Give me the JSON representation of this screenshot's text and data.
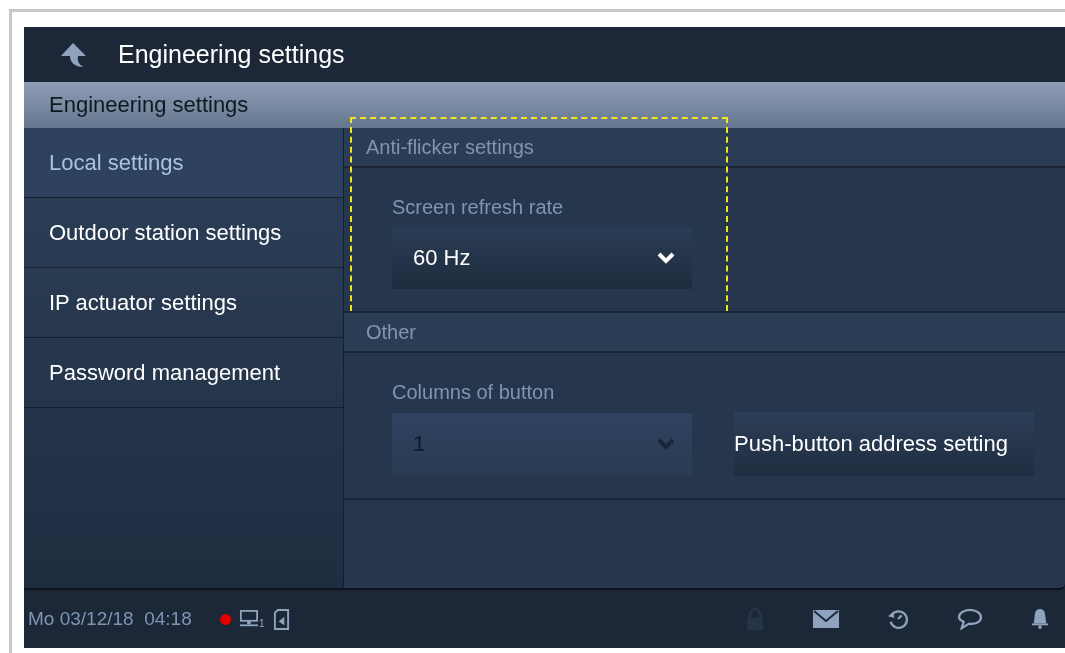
{
  "window": {
    "title": "Engineering settings"
  },
  "header": "Engineering settings",
  "sidebar": {
    "items": [
      {
        "label": "Local settings",
        "selected": true
      },
      {
        "label": "Outdoor station settings",
        "selected": false
      },
      {
        "label": "IP actuator settings",
        "selected": false
      },
      {
        "label": "Password management",
        "selected": false
      }
    ]
  },
  "sections": [
    {
      "title": "Anti-flicker settings",
      "highlighted": true,
      "fields": [
        {
          "label": "Screen refresh rate",
          "value": "60 Hz",
          "disabled": false
        }
      ]
    },
    {
      "title": "Other",
      "highlighted": false,
      "fields": [
        {
          "label": "Columns of button",
          "value": "1",
          "disabled": true
        }
      ],
      "button": "Push-button address setting"
    }
  ],
  "status_bar": {
    "datetime": "Mo 03/12/18  04:18",
    "alert": true,
    "network_count": "1",
    "lock_disabled": true
  }
}
